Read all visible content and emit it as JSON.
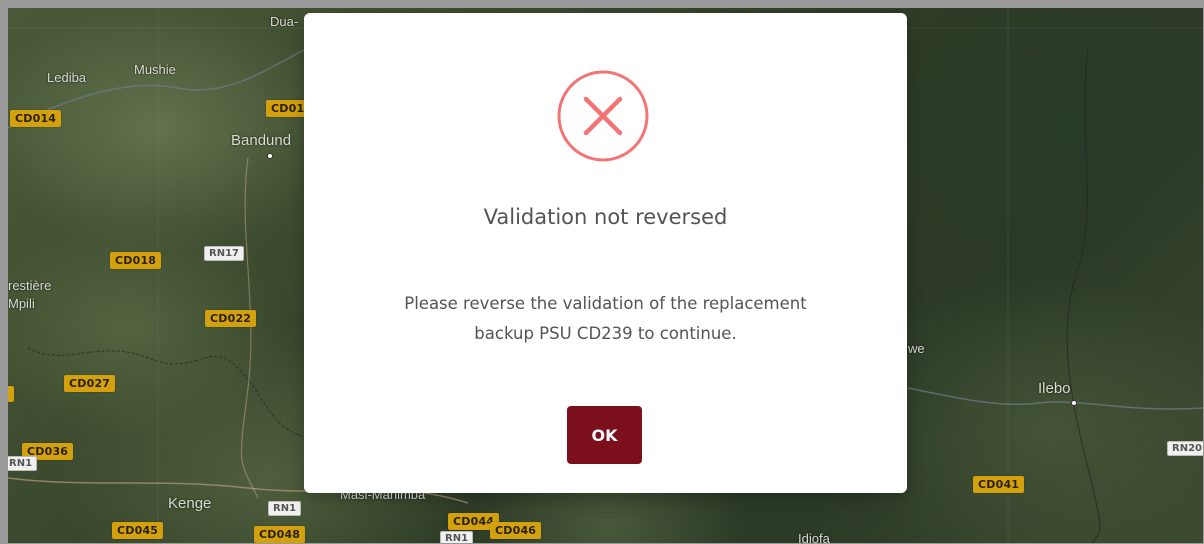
{
  "modal": {
    "icon": "error-x-icon",
    "title": "Validation not reversed",
    "message_line1": "Please reverse the validation of the replacement",
    "message_line2": "backup PSU CD239 to continue.",
    "ok_label": "OK",
    "icon_color": "#f27474",
    "button_color": "#7b0f1c"
  },
  "map": {
    "cities": [
      "Dua-",
      "Lediba",
      "Mushie",
      "Bandund",
      "restière",
      "Mpili",
      "Kenge",
      "Masi-Manimba",
      "Ilebo",
      "we",
      "Idiofa"
    ],
    "psu_labels": [
      "CD014",
      "CD01",
      "CD018",
      "CD022",
      "CD027",
      "CD036",
      "CD045",
      "CD048",
      "CD044",
      "CD046",
      "CD041"
    ],
    "road_labels": [
      "RN17",
      "RN1",
      "RN1",
      "RN1",
      "RN20"
    ]
  }
}
